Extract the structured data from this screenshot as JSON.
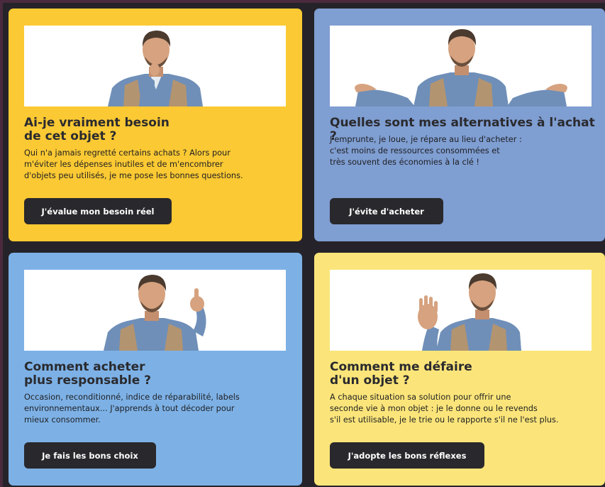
{
  "cards": [
    {
      "title": "Ai-je vraiment besoin\nde cet objet ?",
      "description": "Qui n'a jamais regretté certains achats ? Alors pour\nm'éviter les dépenses inutiles et de m'encombrer\nd'objets peu utilisés, je me pose les bonnes questions.",
      "button": "J'évalue mon besoin réel",
      "background": "#fbc933",
      "photo_icon": "thinking-man-icon"
    },
    {
      "title": "Quelles sont mes alternatives à l'achat ?",
      "description": "J'emprunte, je loue, je répare au lieu d'acheter :\nc'est moins de ressources consommées et\ntrès souvent des économies à la clé !",
      "button": "J'évite d'acheter",
      "background": "#7f9ed2",
      "photo_icon": "shrugging-man-icon"
    },
    {
      "title": "Comment acheter\nplus responsable ?",
      "description": "Occasion, reconditionné, indice de réparabilité, labels\nenvironnementaux... J'apprends à tout décoder pour\nmieux consommer.",
      "button": "Je fais les bons choix",
      "background": "#7db1e6",
      "photo_icon": "pointing-man-icon"
    },
    {
      "title": "Comment me défaire\nd'un objet ?",
      "description": "A chaque situation sa solution pour offrir une\nseconde vie à mon objet : je le donne ou le revends\ns'il est utilisable, je le trie ou le rapporte s'il ne l'est plus.",
      "button": "J'adopte les bons réflexes",
      "background": "#fbe57a",
      "photo_icon": "waving-man-icon"
    }
  ],
  "colors": {
    "page_background": "#252329",
    "button_background": "#29282c",
    "button_text": "#ffffff",
    "title_text": "#2a2a2e"
  }
}
